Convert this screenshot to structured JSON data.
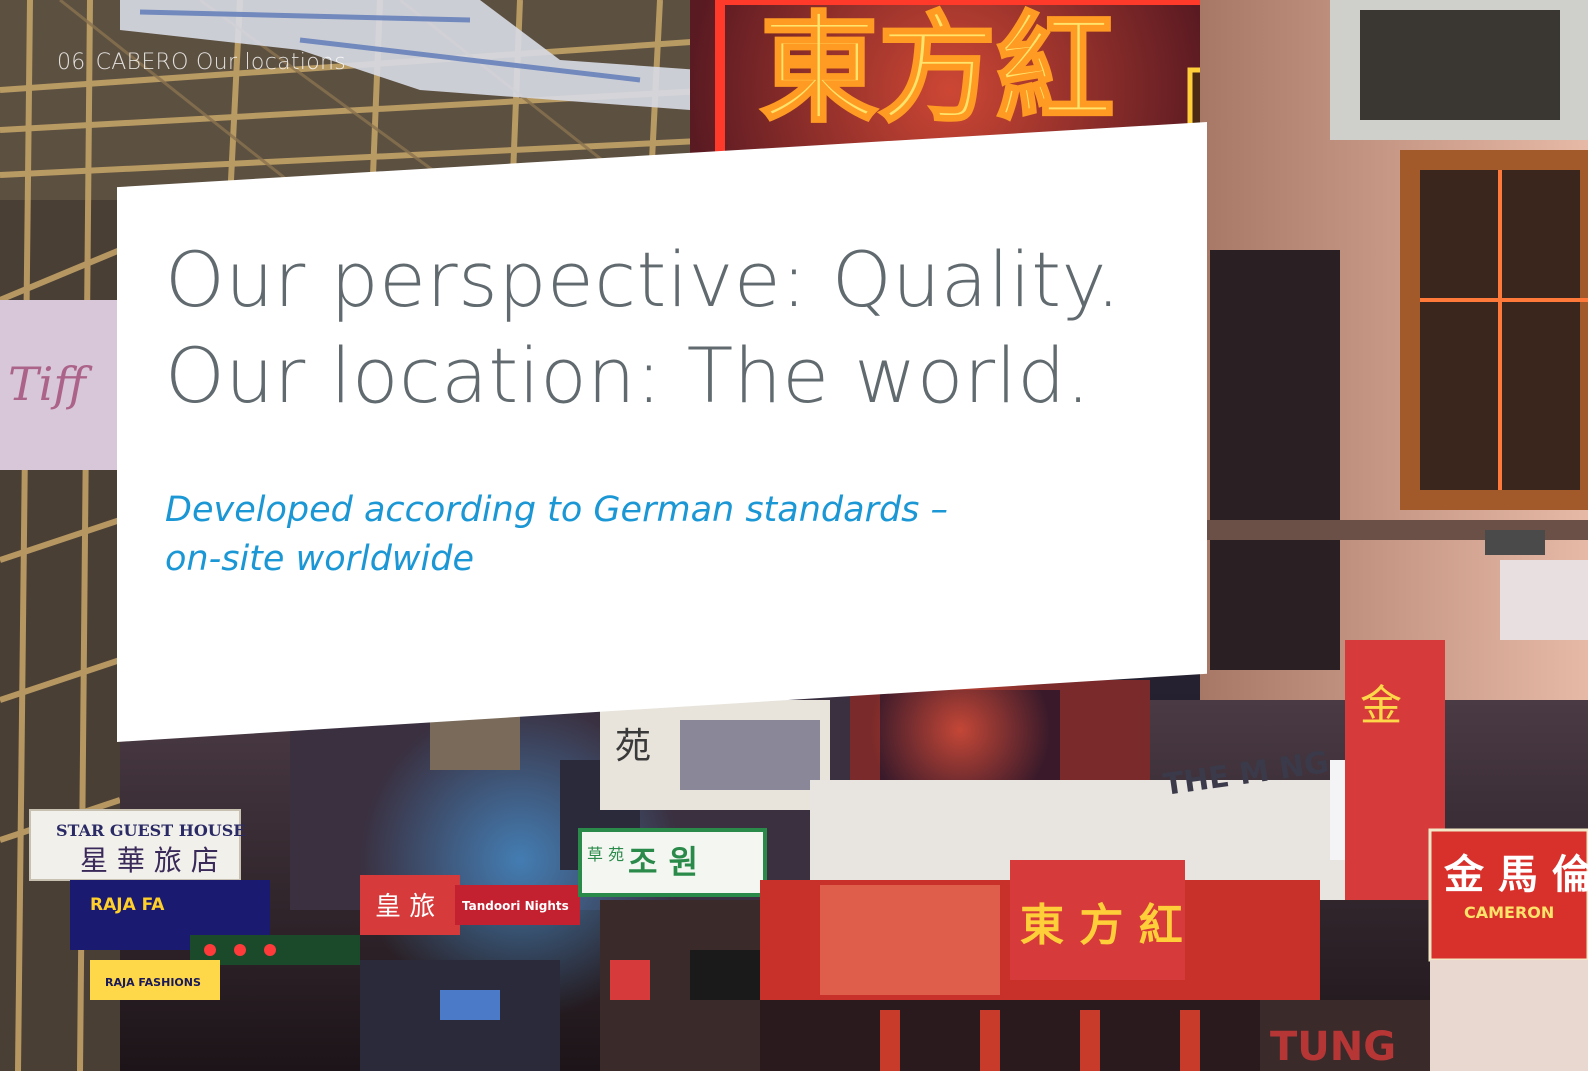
{
  "header": {
    "page_number": "06",
    "section": "CABERO Our locations"
  },
  "card": {
    "headline_line1": "Our perspective: Quality.",
    "headline_line2": "Our location: The world.",
    "subline_line1": "Developed according to German standards –",
    "subline_line2": "on-site worldwide"
  },
  "photo": {
    "signs": {
      "star_guest_house": "STAR GUEST HOUSE",
      "star_guest_house_cn": "星 華 旅 店",
      "raja_fa": "RAJA FA",
      "raja_fashions": "RAJA FASHIONS",
      "hotel_cn": "皇 旅",
      "tandoori_nights": "Tandoori Nights",
      "korean": "조 원",
      "korean_side": "草 苑",
      "the_mang": "THE M NG",
      "fong": "東 方 紅",
      "cameron": "CAMERON",
      "cameron_cn": "金 馬 倫",
      "neon_big": "東方紅",
      "yuen": "苑",
      "tung": "TUNG"
    }
  }
}
